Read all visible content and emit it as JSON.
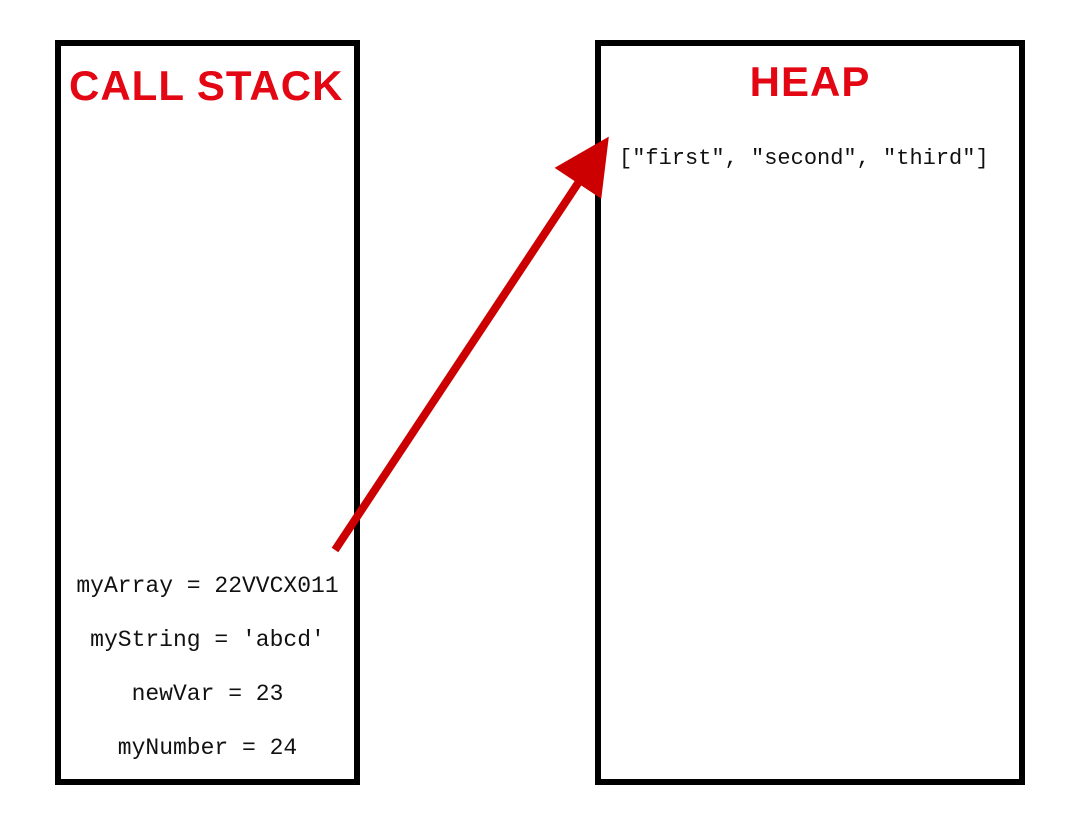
{
  "colors": {
    "accent": "#e30613",
    "border": "#000000"
  },
  "stack": {
    "title": "CALL STACK",
    "items": [
      "myArray = 22VVCX011",
      "myString = 'abcd'",
      "newVar = 23",
      "myNumber = 24"
    ]
  },
  "heap": {
    "title": "HEAP",
    "value": "[\"first\", \"second\", \"third\"]"
  },
  "arrow": {
    "from": "stack.items.0",
    "to": "heap.value"
  }
}
